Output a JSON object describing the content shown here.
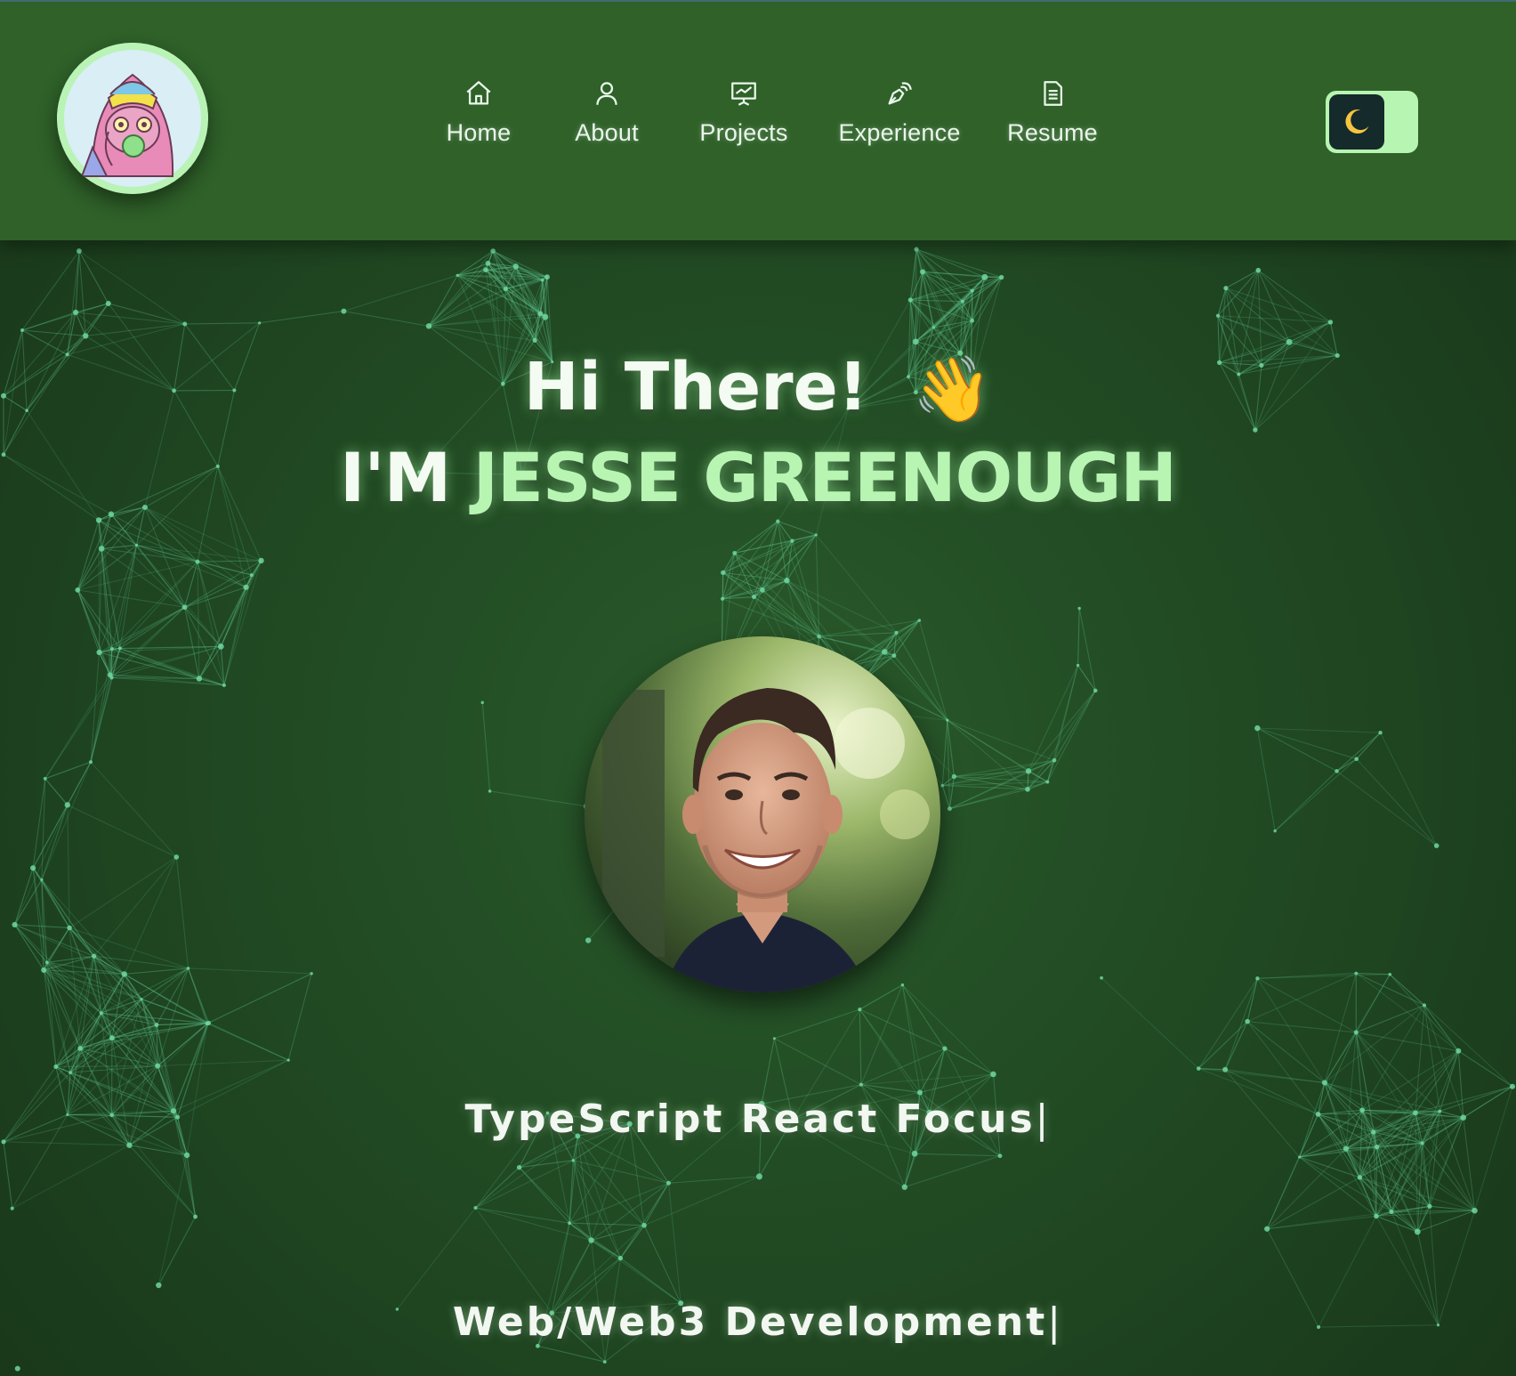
{
  "navbar": {
    "logo_icon": "cartoon-avatar-logo",
    "items": [
      {
        "label": "Home",
        "icon": "home-icon"
      },
      {
        "label": "About",
        "icon": "user-icon"
      },
      {
        "label": "Projects",
        "icon": "presentation-chart-icon"
      },
      {
        "label": "Experience",
        "icon": "pen-nib-icon"
      },
      {
        "label": "Resume",
        "icon": "document-icon"
      }
    ],
    "theme_toggle": {
      "icon": "moon-icon",
      "state": "dark"
    }
  },
  "hero": {
    "greeting": "Hi There!",
    "wave_emoji": "👋",
    "name_prefix": "I'M",
    "name": "JESSE GREENOUGH",
    "typed_lines": [
      "TypeScript React Focus",
      "Web/Web3 Development"
    ],
    "cursor": "|"
  },
  "colors": {
    "navbar_bg": "#2f6129",
    "page_bg": "#1f4621",
    "accent": "#b8f5b3",
    "text": "#f4fbf2",
    "network_line": "#5bbf8a"
  }
}
